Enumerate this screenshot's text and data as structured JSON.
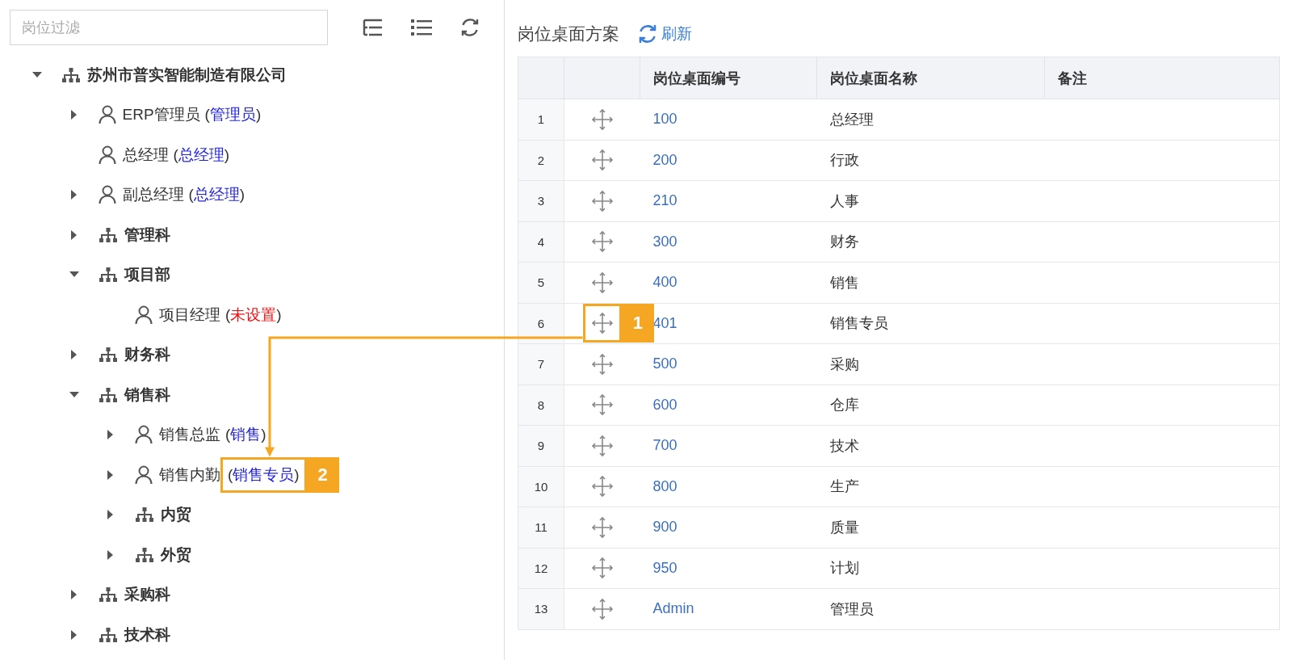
{
  "filter_field": {
    "placeholder": "岗位过滤"
  },
  "tree": [
    {
      "kind": "org",
      "label": "苏州市普实智能制造有限公司",
      "expanded": true,
      "children": [
        {
          "kind": "person",
          "label": "ERP管理员",
          "expanded": false,
          "role": {
            "open": "(",
            "text": "管理员",
            "close": ")",
            "color": "#1f1fe0"
          }
        },
        {
          "kind": "person",
          "label": "总经理",
          "role": {
            "open": "(",
            "text": "总经理",
            "close": ")",
            "color": "#1f1fe0"
          }
        },
        {
          "kind": "person",
          "label": "副总经理",
          "expanded": false,
          "role": {
            "open": "(",
            "text": "总经理",
            "close": ")",
            "color": "#1f1fe0"
          }
        },
        {
          "kind": "org",
          "label": "管理科",
          "expanded": false
        },
        {
          "kind": "org",
          "label": "项目部",
          "expanded": true,
          "children": [
            {
              "kind": "person",
              "label": "项目经理",
              "role": {
                "open": "(",
                "text": "未设置",
                "close": ")",
                "color": "#ee1111"
              }
            }
          ]
        },
        {
          "kind": "org",
          "label": "财务科",
          "expanded": false
        },
        {
          "kind": "org",
          "label": "销售科",
          "expanded": true,
          "children": [
            {
              "kind": "person",
              "label": "销售总监",
              "expanded": false,
              "role": {
                "open": "(",
                "text": "销售",
                "close": ")",
                "color": "#1f1fe0"
              }
            },
            {
              "kind": "person",
              "label": "销售内勤",
              "expanded": false,
              "role": {
                "open": "(",
                "text": "销售专员",
                "close": ")",
                "color": "#1f1fe0"
              },
              "callout": "2"
            },
            {
              "kind": "org",
              "label": "内贸",
              "expanded": false
            },
            {
              "kind": "org",
              "label": "外贸",
              "expanded": false
            }
          ]
        },
        {
          "kind": "org",
          "label": "采购科",
          "expanded": false
        },
        {
          "kind": "org",
          "label": "技术科",
          "expanded": false
        }
      ]
    }
  ],
  "desk_panel": {
    "title": "岗位桌面方案",
    "refresh_button": "刷新",
    "columns": [
      {
        "label": "岗位桌面编号"
      },
      {
        "label": "岗位桌面名称"
      },
      {
        "label": "备注"
      }
    ],
    "rows": [
      {
        "index": "1",
        "code": "100",
        "name": "总经理"
      },
      {
        "index": "2",
        "code": "200",
        "name": "行政"
      },
      {
        "index": "3",
        "code": "210",
        "name": "人事"
      },
      {
        "index": "4",
        "code": "300",
        "name": "财务"
      },
      {
        "index": "5",
        "code": "400",
        "name": "销售"
      },
      {
        "index": "6",
        "code": "401",
        "name": "销售专员",
        "callout": "1"
      },
      {
        "index": "7",
        "code": "500",
        "name": "采购"
      },
      {
        "index": "8",
        "code": "600",
        "name": "仓库"
      },
      {
        "index": "9",
        "code": "700",
        "name": "技术"
      },
      {
        "index": "10",
        "code": "800",
        "name": "生产"
      },
      {
        "index": "11",
        "code": "900",
        "name": "质量"
      },
      {
        "index": "12",
        "code": "950",
        "name": "计划"
      },
      {
        "index": "13",
        "code": "Admin",
        "name": "管理员"
      }
    ]
  }
}
